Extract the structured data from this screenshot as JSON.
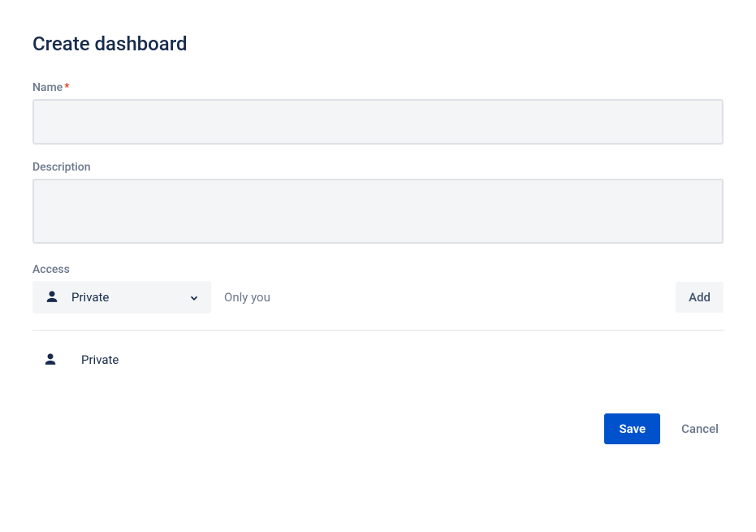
{
  "page": {
    "title": "Create dashboard"
  },
  "form": {
    "name": {
      "label": "Name",
      "required_marker": "*",
      "value": ""
    },
    "description": {
      "label": "Description",
      "value": ""
    },
    "access": {
      "label": "Access",
      "dropdown": {
        "selected": "Private"
      },
      "hint": "Only you",
      "add_button": "Add",
      "items": [
        {
          "label": "Private"
        }
      ]
    }
  },
  "actions": {
    "save": "Save",
    "cancel": "Cancel"
  }
}
